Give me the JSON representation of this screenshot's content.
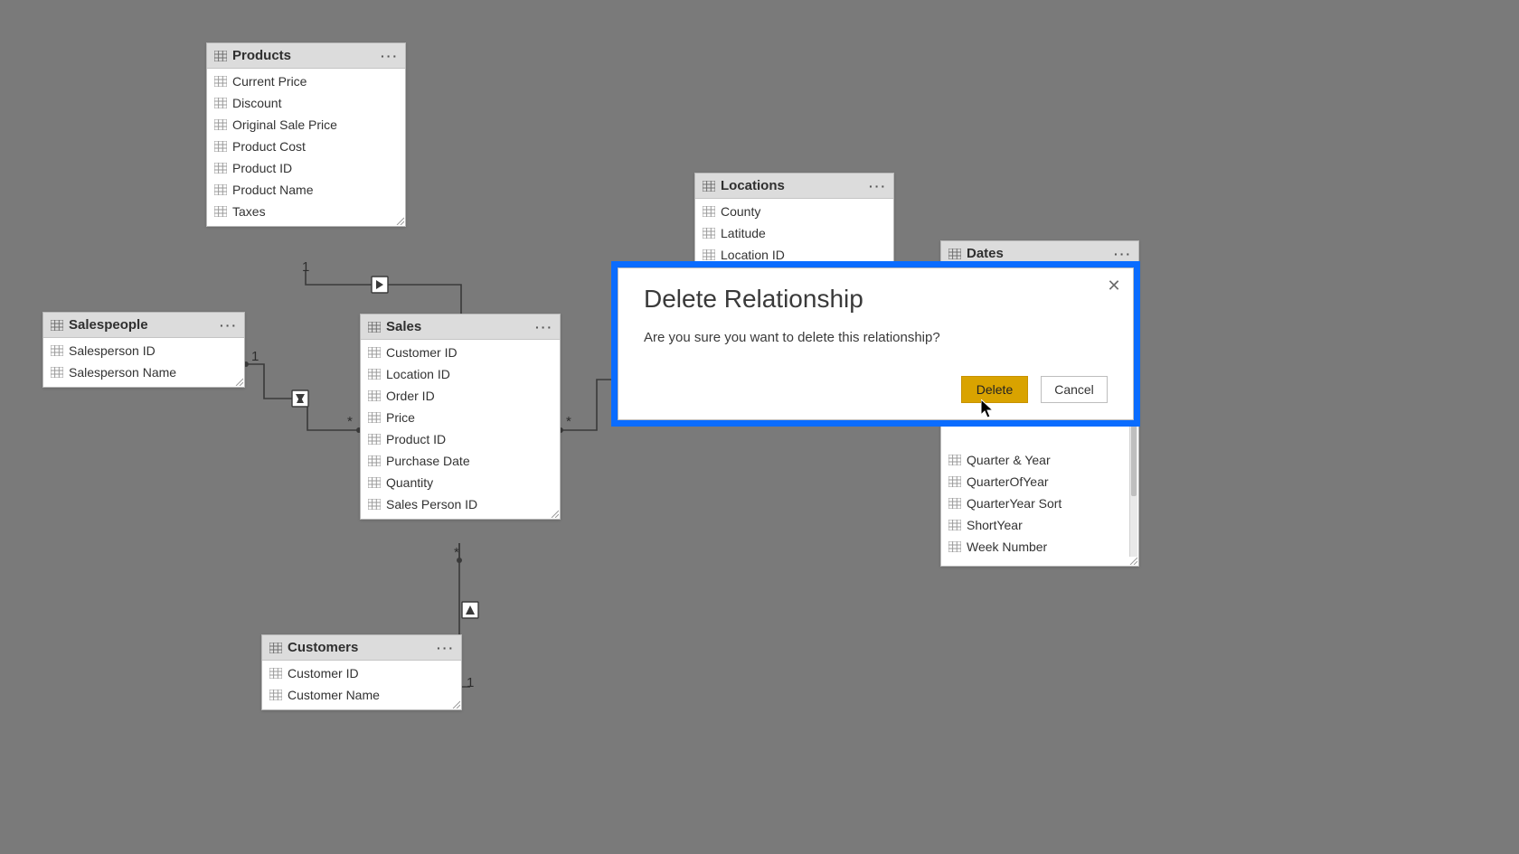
{
  "dialog": {
    "title": "Delete Relationship",
    "message": "Are you sure you want to delete this relationship?",
    "delete_label": "Delete",
    "cancel_label": "Cancel"
  },
  "tables": {
    "products": {
      "title": "Products",
      "fields": [
        "Current Price",
        "Discount",
        "Original Sale Price",
        "Product Cost",
        "Product ID",
        "Product Name",
        "Taxes"
      ]
    },
    "salespeople": {
      "title": "Salespeople",
      "fields": [
        "Salesperson ID",
        "Salesperson Name"
      ]
    },
    "sales": {
      "title": "Sales",
      "fields": [
        "Customer ID",
        "Location ID",
        "Order ID",
        "Price",
        "Product ID",
        "Purchase Date",
        "Quantity",
        "Sales Person ID"
      ]
    },
    "customers": {
      "title": "Customers",
      "fields": [
        "Customer ID",
        "Customer Name"
      ]
    },
    "locations": {
      "title": "Locations",
      "fields": [
        "County",
        "Latitude",
        "Location ID"
      ]
    },
    "dates": {
      "title": "Dates",
      "fields": [
        "Quarter & Year",
        "QuarterOfYear",
        "QuarterYear Sort",
        "ShortYear",
        "Week Number"
      ]
    }
  },
  "cardinality": {
    "one": "1",
    "many": "*"
  },
  "icon_names": {
    "table": "table-icon",
    "more": "more-icon",
    "close": "close-icon"
  }
}
